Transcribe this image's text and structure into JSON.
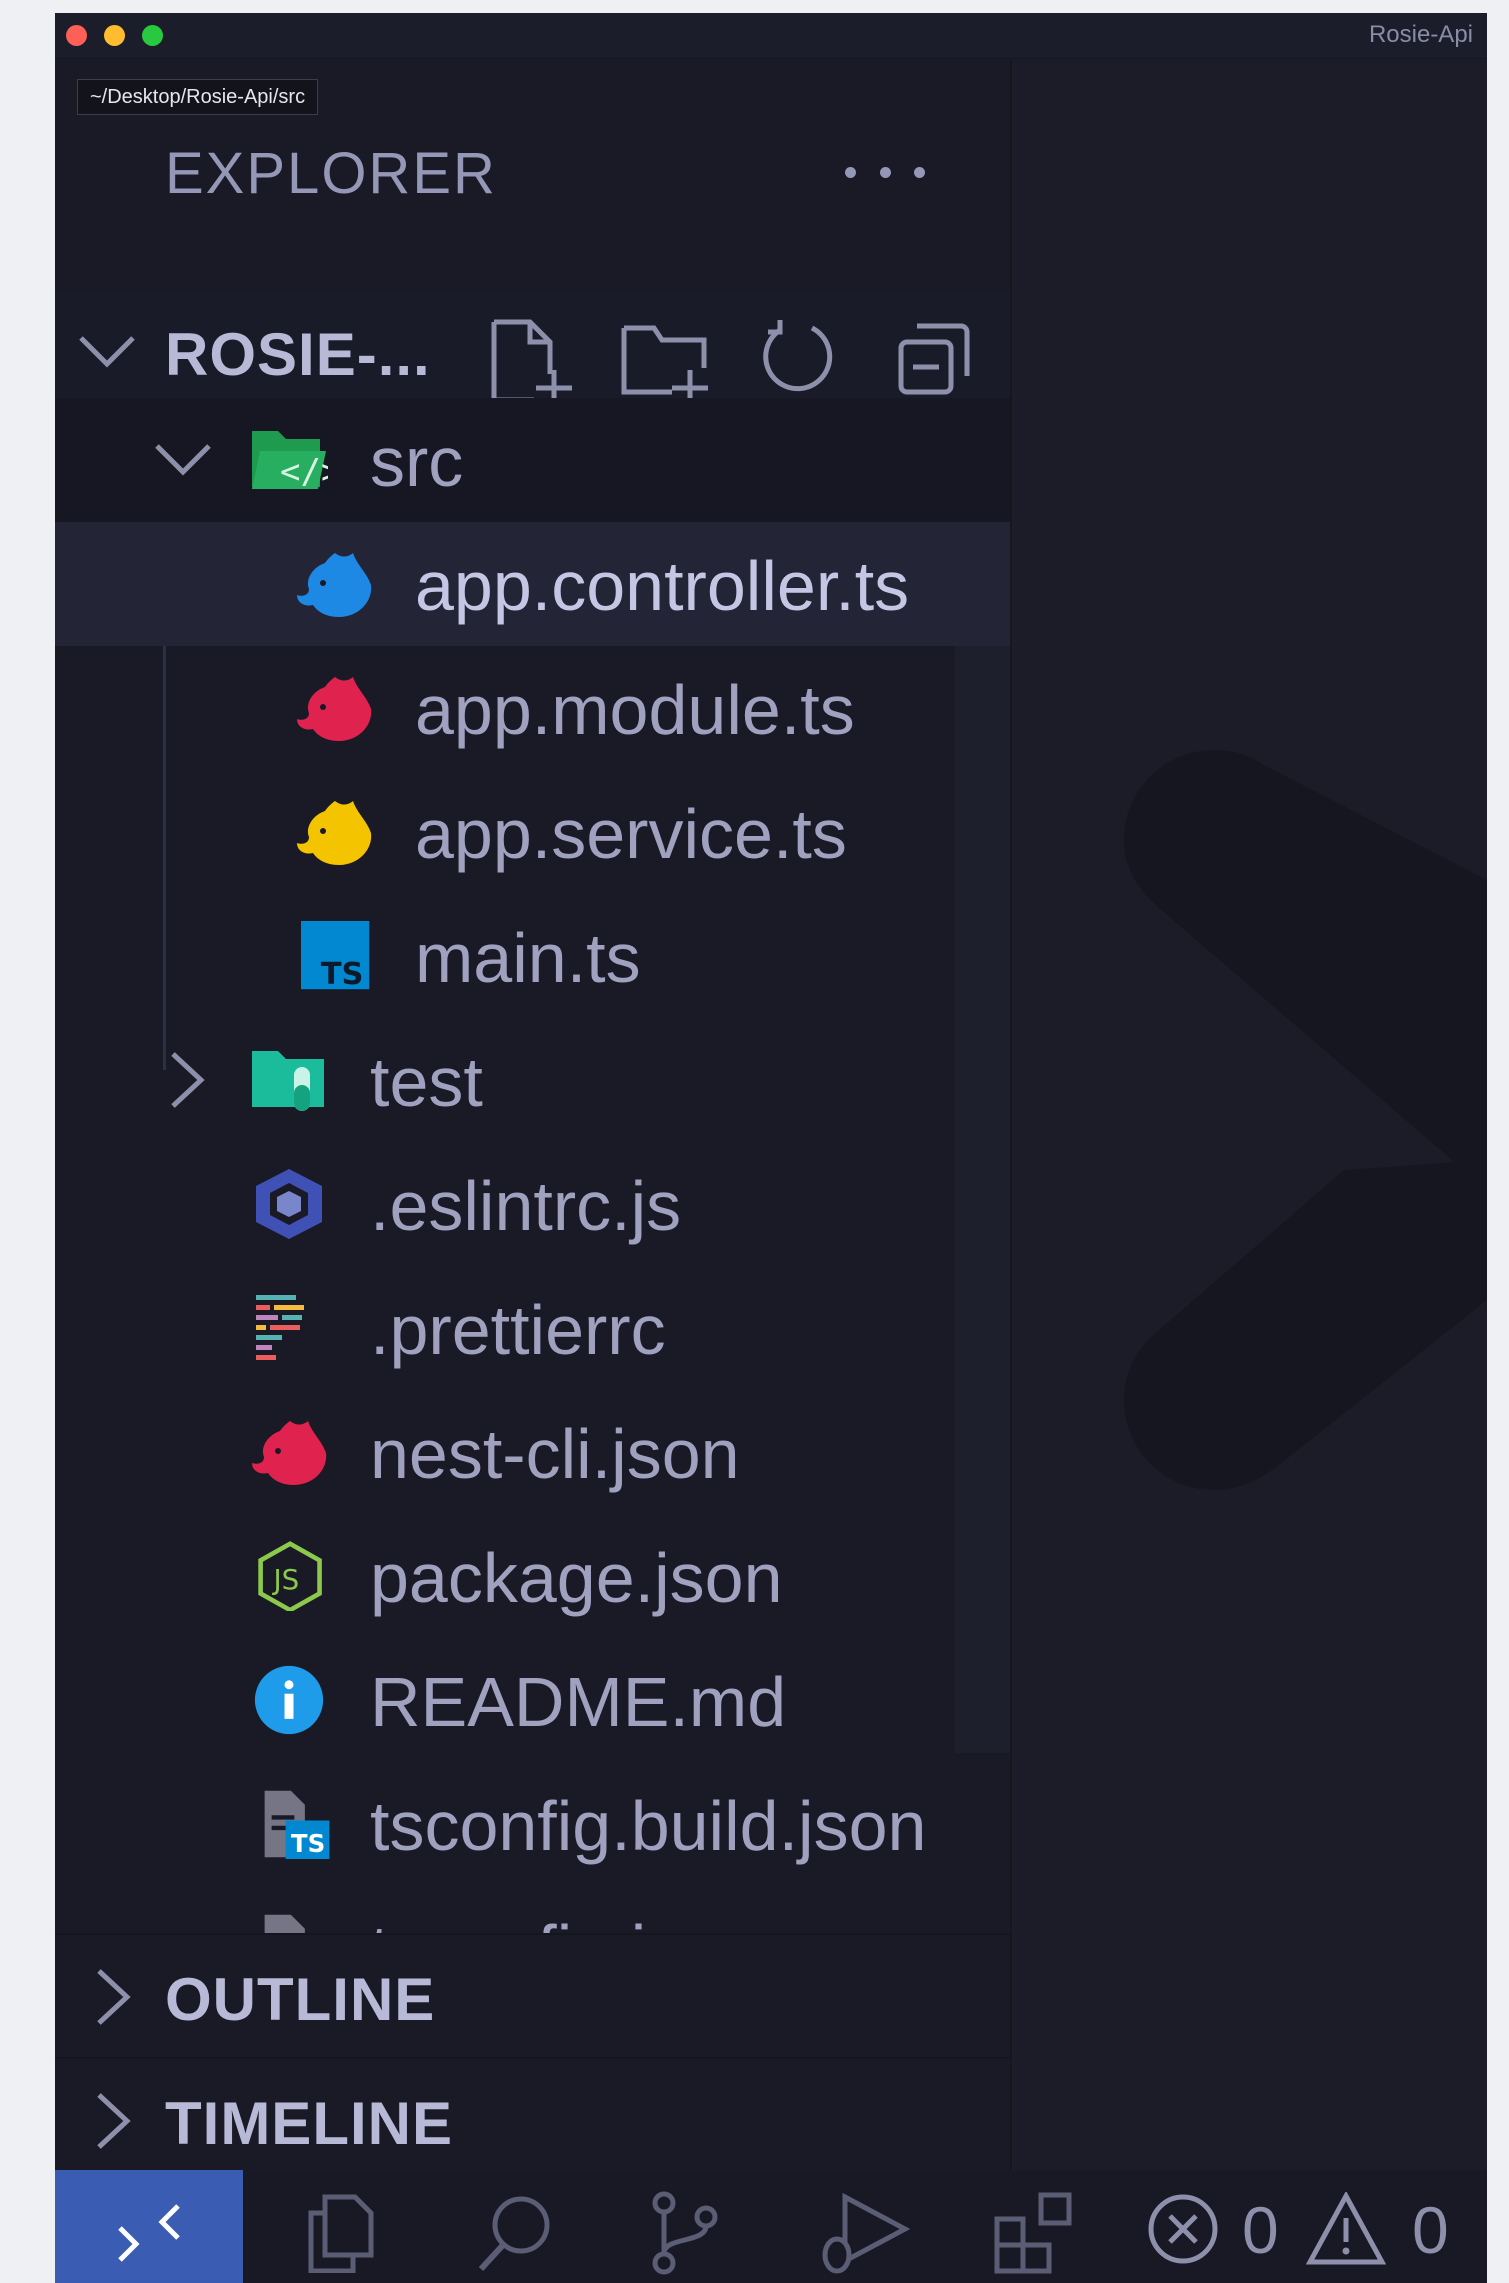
{
  "window": {
    "title": "Rosie-Api"
  },
  "tooltip": {
    "text": "~/Desktop/Rosie-Api/src"
  },
  "explorer": {
    "title": "EXPLORER",
    "more_icon": "ellipsis-icon",
    "root": {
      "label": "ROSIE-...",
      "actions": [
        {
          "name": "new-file-icon"
        },
        {
          "name": "new-folder-icon"
        },
        {
          "name": "refresh-icon"
        },
        {
          "name": "collapse-all-icon"
        }
      ]
    },
    "tree": [
      {
        "label": "src",
        "type": "folder",
        "expanded": true,
        "icon": "folder-src-icon"
      },
      {
        "label": "app.controller.ts",
        "type": "file",
        "selected": true,
        "icon": "nest-controller-icon"
      },
      {
        "label": "app.module.ts",
        "type": "file",
        "icon": "nest-module-icon"
      },
      {
        "label": "app.service.ts",
        "type": "file",
        "icon": "nest-service-icon"
      },
      {
        "label": "main.ts",
        "type": "file",
        "icon": "typescript-icon"
      },
      {
        "label": "test",
        "type": "folder",
        "expanded": false,
        "icon": "folder-test-icon"
      },
      {
        "label": ".eslintrc.js",
        "type": "file",
        "icon": "eslint-icon"
      },
      {
        "label": ".prettierrc",
        "type": "file",
        "icon": "prettier-icon"
      },
      {
        "label": "nest-cli.json",
        "type": "file",
        "icon": "nest-icon"
      },
      {
        "label": "package.json",
        "type": "file",
        "icon": "nodejs-icon"
      },
      {
        "label": "README.md",
        "type": "file",
        "icon": "info-icon"
      },
      {
        "label": "tsconfig.build.json",
        "type": "file",
        "icon": "tsconfig-icon"
      },
      {
        "label": "tsconfig.json",
        "type": "file",
        "icon": "tsconfig-icon"
      }
    ]
  },
  "sections": {
    "outline": "OUTLINE",
    "timeline": "TIMELINE"
  },
  "statusbar": {
    "errors": "0",
    "warnings": "0"
  },
  "colors": {
    "accent": "#3b5cb3",
    "nest_blue": "#1e88e5",
    "nest_red": "#e0234e",
    "nest_yellow": "#f5c400",
    "ts_blue": "#0288d1"
  }
}
